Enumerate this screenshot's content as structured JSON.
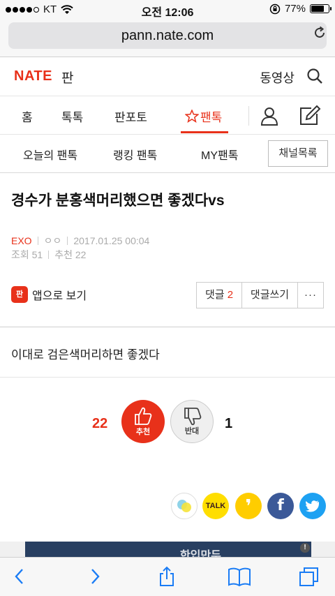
{
  "status_bar": {
    "carrier": "KT",
    "time": "오전 12:06",
    "battery": "77%",
    "battery_level": 0.77
  },
  "browser": {
    "url": "pann.nate.com"
  },
  "header": {
    "logo": "NATE",
    "section": "판",
    "video_link": "동영상"
  },
  "main_tabs": [
    {
      "label": "홈"
    },
    {
      "label": "톡톡"
    },
    {
      "label": "판포토"
    },
    {
      "label": "팬톡",
      "active": true
    }
  ],
  "sub_tabs": [
    {
      "label": "오늘의 팬톡"
    },
    {
      "label": "랭킹 팬톡"
    },
    {
      "label": "MY팬톡"
    }
  ],
  "channel_button": "채널목록",
  "post": {
    "title": "경수가 분홍색머리했으면 좋겠다vs",
    "category": "EXO",
    "author": "ㅇㅇ",
    "date": "2017.01.25 00:04",
    "views": "조회 51",
    "recommends": "추천 22",
    "body": "이대로 검은색머리하면 좋겠다"
  },
  "actions": {
    "app_view": "앱으로 보기",
    "app_icon_text": "판",
    "comment_label": "댓글",
    "comment_count": "2",
    "write_comment": "댓글쓰기",
    "more": "···"
  },
  "votes": {
    "up_count": "22",
    "up_label": "추천",
    "down_label": "반대",
    "down_count": "1"
  },
  "share": {
    "kakaotalk": "TALK",
    "kakaostory": "❜",
    "facebook": "f"
  },
  "ad": {
    "text": "한입만두"
  }
}
